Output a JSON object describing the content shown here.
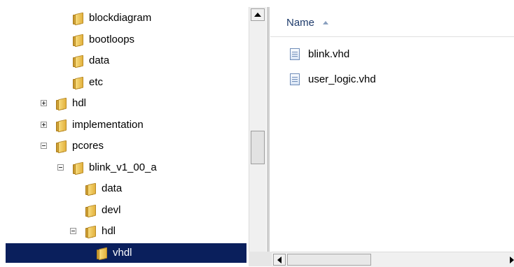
{
  "tree": {
    "items": [
      {
        "label": "blockdiagram",
        "depth": 2,
        "expander": "none",
        "selected": false
      },
      {
        "label": "bootloops",
        "depth": 2,
        "expander": "none",
        "selected": false
      },
      {
        "label": "data",
        "depth": 2,
        "expander": "none",
        "selected": false
      },
      {
        "label": "etc",
        "depth": 2,
        "expander": "none",
        "selected": false
      },
      {
        "label": "hdl",
        "depth": 1,
        "expander": "plus",
        "selected": false
      },
      {
        "label": "implementation",
        "depth": 1,
        "expander": "plus",
        "selected": false
      },
      {
        "label": "pcores",
        "depth": 1,
        "expander": "minus",
        "selected": false
      },
      {
        "label": "blink_v1_00_a",
        "depth": 2,
        "expander": "minus",
        "selected": false
      },
      {
        "label": "data",
        "depth": 3,
        "expander": "none",
        "selected": false
      },
      {
        "label": "devl",
        "depth": 3,
        "expander": "none",
        "selected": false
      },
      {
        "label": "hdl",
        "depth": 3,
        "expander": "minus",
        "selected": false
      },
      {
        "label": "vhdl",
        "depth": 4,
        "expander": "none",
        "selected": true
      }
    ]
  },
  "file_list": {
    "column_header": "Name",
    "sort_direction": "ascending",
    "files": [
      {
        "label": "blink.vhd",
        "icon": "vhd-file-icon"
      },
      {
        "label": "user_logic.vhd",
        "icon": "vhd-file-icon"
      }
    ]
  },
  "colors": {
    "selection_bg": "#0a1f5c",
    "header_text": "#1e3b6b"
  }
}
